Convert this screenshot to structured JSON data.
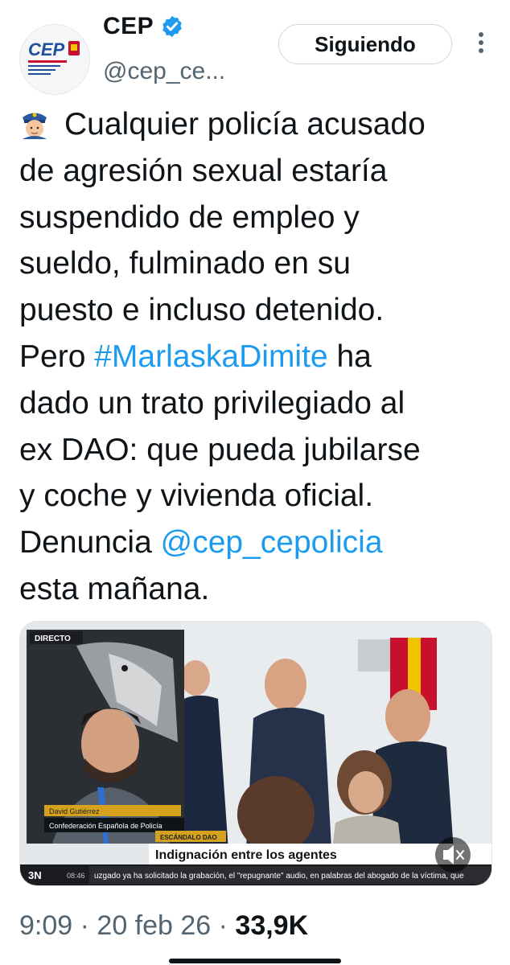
{
  "author": {
    "display_name": "CEP",
    "handle": "@cep_ce...",
    "verified_icon": "verified-badge-icon",
    "avatar_text": "CEP",
    "avatar_subtext": "Confederación Española de Policía",
    "accent_color": "#1d9bf0"
  },
  "header": {
    "follow_label": "Siguiendo",
    "more_icon": "more-vertical-icon"
  },
  "tweet": {
    "emoji_icon": "police-officer-emoji",
    "line1": "Cualquier policía acusado",
    "line2": "de agresión sexual estaría",
    "line3": "suspendido de empleo y",
    "line4": "sueldo, fulminado en su",
    "line5": "puesto e incluso detenido.",
    "line6_prefix": "Pero ",
    "hashtag": "#MarlaskaDimite",
    "line6_suffix": " ha",
    "line7": "dado un trato privilegiado al",
    "line8": "ex DAO: que pueda jubilarse",
    "line9": "y coche y vivienda oficial.",
    "line10_prefix": "Denuncia ",
    "mention": "@cep_cepolicia",
    "line11": "esta mañana."
  },
  "video": {
    "live_label": "DIRECTO",
    "person_name": "David Gutiérrez",
    "person_org": "Confederación Española de Policía",
    "topic_label": "ESCÁNDALO DAO",
    "headline": "Indignación entre los agentes",
    "channel": "3N",
    "time": "08:46",
    "ticker": "uzgado ya ha solicitado la grabación, el \"repugnante\" audio, en palabras del abogado de la víctima, que",
    "mute_icon": "speaker-muted-icon"
  },
  "meta": {
    "time": "9:09",
    "sep1": " · ",
    "date": "20 feb 26",
    "sep2": " · ",
    "views": "33,9K"
  }
}
